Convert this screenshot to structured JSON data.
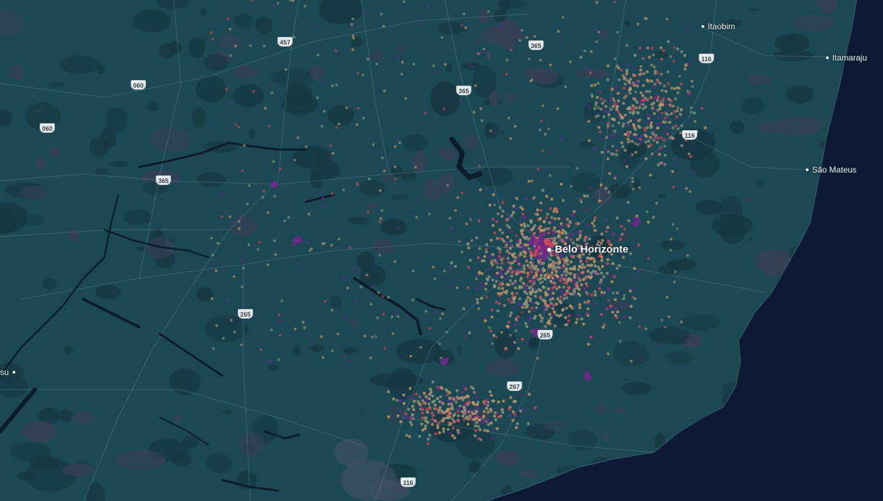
{
  "map": {
    "cities": [
      {
        "name": "Itaobim",
        "major": false,
        "key": "itaobim"
      },
      {
        "name": "Itamaraju",
        "major": false,
        "key": "itamaraju"
      },
      {
        "name": "São Mateus",
        "major": false,
        "key": "sao-mateus"
      },
      {
        "name": "Belo Horizonte",
        "major": true,
        "key": "belo-horizonte"
      },
      {
        "name": "su",
        "major": false,
        "key": "partial-west"
      }
    ],
    "highway_shields": [
      "457",
      "365",
      "060",
      "060",
      "365",
      "365",
      "116",
      "116",
      "265",
      "265",
      "267",
      "116"
    ],
    "colors": {
      "land": "#1c4854",
      "ocean": "#0e1a35",
      "dark_land": "#16363f",
      "water": "#0b1d2b",
      "road": "#5f8893",
      "density_low": "#cc9966",
      "density_mid": "#d1465a",
      "density_high": "#6b2a8a"
    }
  }
}
